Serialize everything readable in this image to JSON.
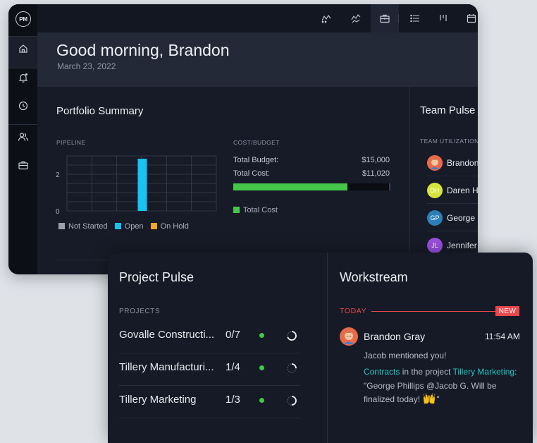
{
  "app": {
    "logo": "PM"
  },
  "sidebar": {
    "icons": [
      "home-icon",
      "bell-icon",
      "clock-icon",
      "users-icon",
      "briefcase-icon"
    ]
  },
  "topbar": {
    "icons": [
      "dashboard-icon",
      "team-pulse-icon",
      "portfolio-icon",
      "list-icon",
      "board-icon",
      "calendar-icon"
    ]
  },
  "header": {
    "greeting": "Good morning, Brandon",
    "date": "March 23, 2022"
  },
  "portfolio": {
    "title": "Portfolio Summary",
    "pipeline_label": "PIPELINE",
    "cost_label": "COST/BUDGET",
    "total_budget_label": "Total Budget:",
    "total_budget_value": "$15,000",
    "total_cost_label": "Total Cost:",
    "total_cost_value": "$11,020",
    "cost_legend": "Total Cost",
    "cost_fraction": 0.7347,
    "cost_color": "#45c64a"
  },
  "chart_data": {
    "type": "bar",
    "categories": [
      "Not Started",
      "Open",
      "On Hold"
    ],
    "values": [
      0,
      3,
      0
    ],
    "ylim": [
      0,
      3
    ],
    "yticks": [
      "0",
      "2"
    ],
    "legend": [
      "Not Started",
      "Open",
      "On Hold"
    ],
    "colors": [
      "#9aa1ad",
      "#18c3f0",
      "#f5a623"
    ]
  },
  "team": {
    "title": "Team Pulse",
    "utilization_label": "TEAM UTILIZATION",
    "members": [
      {
        "name": "Brandon",
        "initials": "",
        "color": "#e9694a"
      },
      {
        "name": "Daren H",
        "initials": "DH",
        "color": "#d6e53a"
      },
      {
        "name": "George",
        "initials": "GP",
        "color": "#2d7fb8"
      },
      {
        "name": "Jennifer",
        "initials": "JL",
        "color": "#9b4fe0"
      }
    ]
  },
  "project_pulse": {
    "title": "Project Pulse",
    "projects_label": "PROJECTS",
    "rows": [
      {
        "name": "Govalle Constructi...",
        "count": "0/7",
        "progress": 0.7
      },
      {
        "name": "Tillery Manufacturi...",
        "count": "1/4",
        "progress": 0.25
      },
      {
        "name": "Tillery Marketing",
        "count": "1/3",
        "progress": 0.5
      }
    ]
  },
  "workstream": {
    "title": "Workstream",
    "today_label": "TODAY",
    "new_label": "NEW",
    "author": "Brandon Gray",
    "time": "11:54 AM",
    "message": "Jacob mentioned you!",
    "link1": "Contracts",
    "in_project": " in the project ",
    "link2": "Tillery Marketing",
    "quote": ": \"George Phillips @Jacob G. Will be finalized today! ",
    "quote_end": "\"",
    "emoji": "raised-hands-icon"
  }
}
